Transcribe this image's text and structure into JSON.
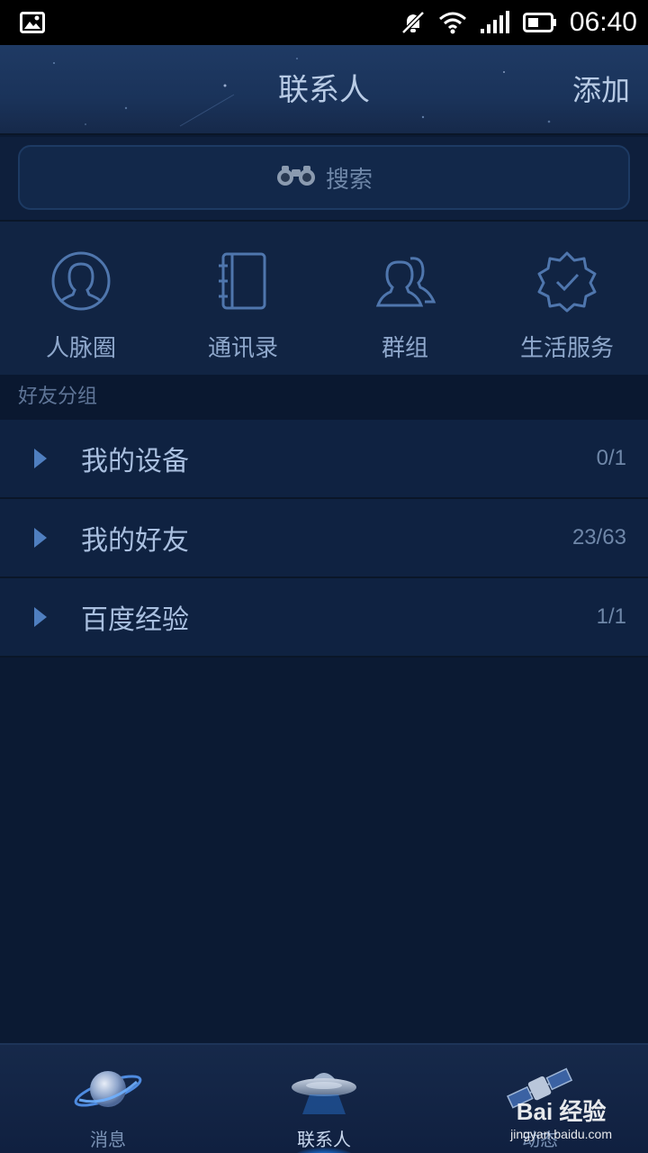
{
  "status_bar": {
    "time": "06:40",
    "icons": [
      "gallery-icon",
      "mute-icon",
      "wifi-icon",
      "signal-icon",
      "battery-icon"
    ]
  },
  "header": {
    "title": "联系人",
    "action_label": "添加"
  },
  "search": {
    "label": "搜索",
    "icon": "binoculars-icon"
  },
  "quick_access": [
    {
      "label": "人脉圈",
      "icon": "person-circle-icon"
    },
    {
      "label": "通讯录",
      "icon": "address-book-icon"
    },
    {
      "label": "群组",
      "icon": "group-icon"
    },
    {
      "label": "生活服务",
      "icon": "verified-badge-icon"
    }
  ],
  "groups_header": "好友分组",
  "groups": [
    {
      "name": "我的设备",
      "count": "0/1"
    },
    {
      "name": "我的好友",
      "count": "23/63"
    },
    {
      "name": "百度经验",
      "count": "1/1"
    }
  ],
  "bottom_nav": [
    {
      "label": "消息",
      "icon": "planet-icon",
      "active": false
    },
    {
      "label": "联系人",
      "icon": "ufo-icon",
      "active": true
    },
    {
      "label": "动态",
      "icon": "satellite-icon",
      "active": false
    }
  ],
  "watermark": {
    "line1": "Bai  经验",
    "line2": "jingyan.baidu.com"
  },
  "colors": {
    "background": "#0b1a33",
    "header": "#1a335a",
    "accent_glow": "#3aa8ff",
    "text": "#a9bfdf"
  }
}
